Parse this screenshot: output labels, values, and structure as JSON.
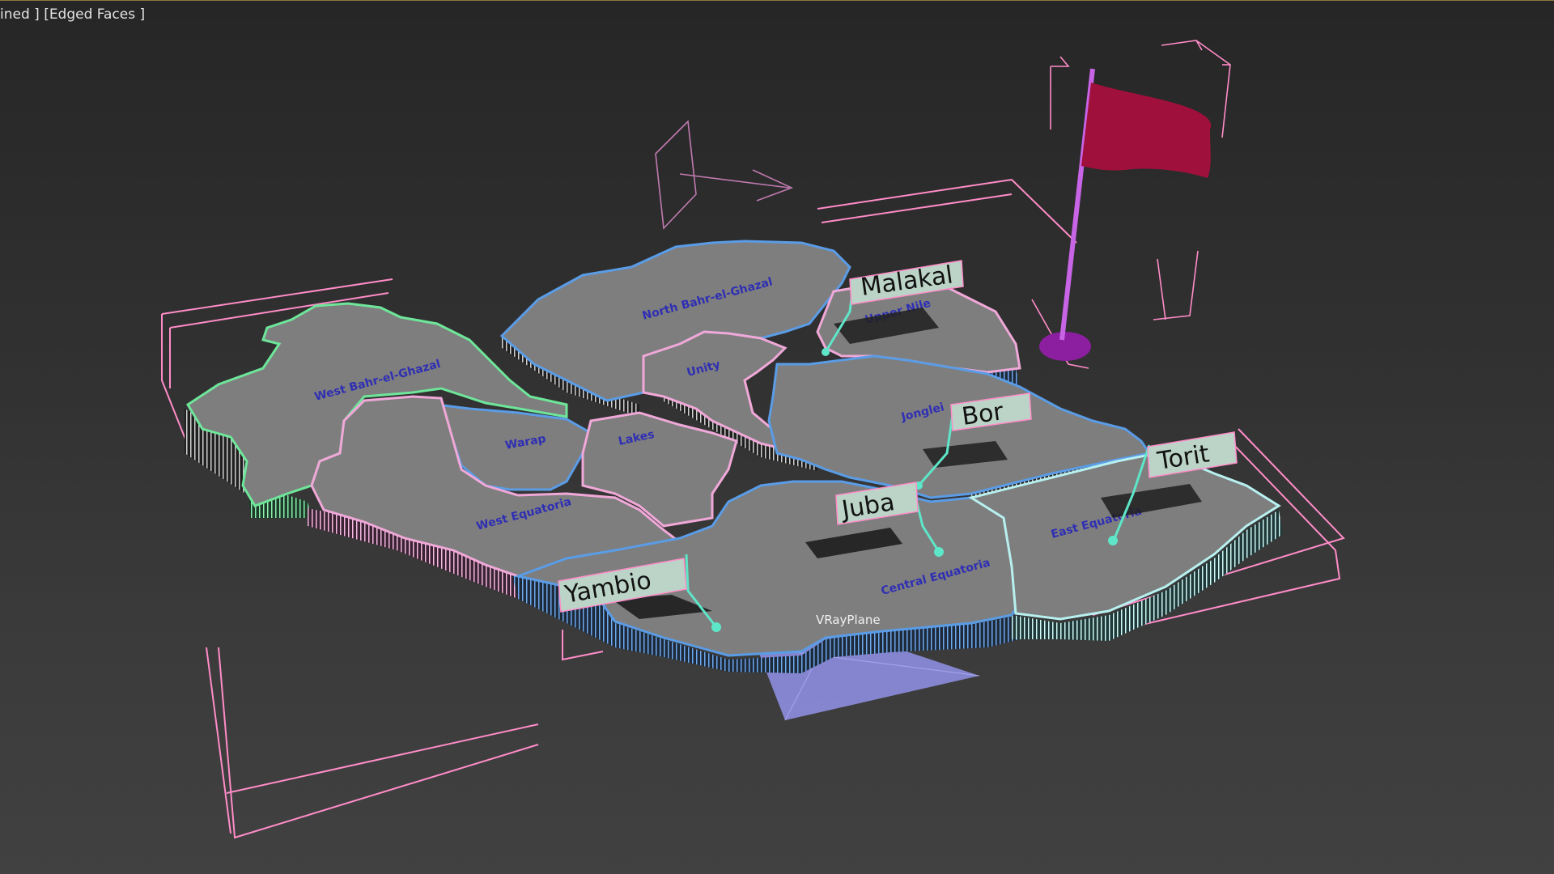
{
  "viewport": {
    "label": "ined ] [Edged Faces ]"
  },
  "map": {
    "regions": [
      {
        "name": "West Bahr-el-Ghazal"
      },
      {
        "name": "North Bahr-el-Ghazal"
      },
      {
        "name": "Upper Nile"
      },
      {
        "name": "Unity"
      },
      {
        "name": "Warap"
      },
      {
        "name": "Lakes"
      },
      {
        "name": "Jonglei"
      },
      {
        "name": "West Equatoria"
      },
      {
        "name": "Central Equatoria"
      },
      {
        "name": "East Equatoria"
      }
    ],
    "cities": [
      {
        "name": "Malakal"
      },
      {
        "name": "Bor"
      },
      {
        "name": "Torit"
      },
      {
        "name": "Juba"
      },
      {
        "name": "Yambio"
      }
    ]
  },
  "objects": {
    "plane_label": "VRayPlane"
  },
  "colors": {
    "region_fill": "#7e7e7e",
    "outline_blue": "#5a9ce6",
    "outline_pink": "#f0a8d8",
    "outline_green": "#6ee69a",
    "outline_cyan": "#b8f0f0",
    "selection_box": "#ff8cc8",
    "leader_line": "#5ee6c8",
    "label_plate": "#bcd4c8",
    "flag": "#a0103c",
    "flag_pole": "#c864e6",
    "flag_base": "#8c1ea0",
    "vray_plane": "#8c8cdc",
    "region_text": "#2f2fb4"
  }
}
